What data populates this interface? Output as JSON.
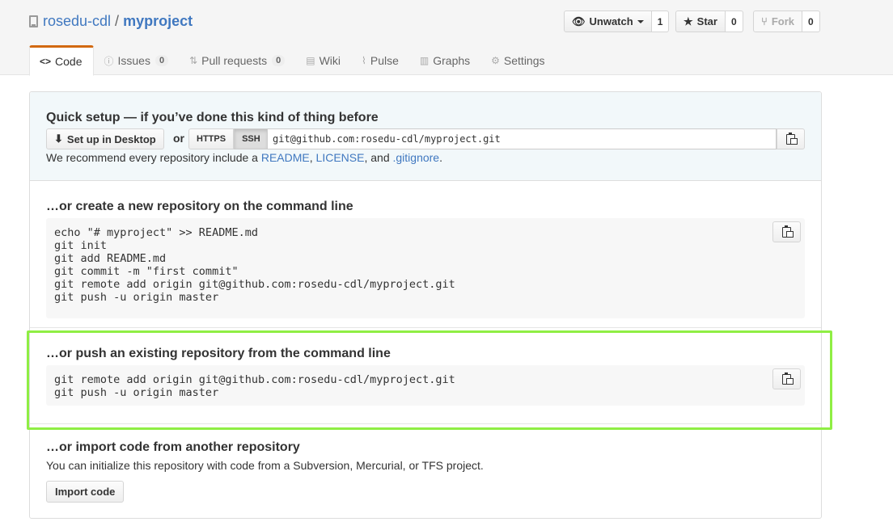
{
  "repo": {
    "owner": "rosedu-cdl",
    "separator": "/",
    "name": "myproject"
  },
  "actions": {
    "watch": {
      "label": "Unwatch",
      "icon": "eye-icon",
      "count": "1"
    },
    "star": {
      "label": "Star",
      "icon": "star-icon",
      "count": "0"
    },
    "fork": {
      "label": "Fork",
      "icon": "fork-icon",
      "count": "0"
    }
  },
  "tabs": [
    {
      "label": "Code",
      "icon": "code-icon",
      "active": true
    },
    {
      "label": "Issues",
      "icon": "issue-icon",
      "counter": "0"
    },
    {
      "label": "Pull requests",
      "icon": "pull-request-icon",
      "counter": "0"
    },
    {
      "label": "Wiki",
      "icon": "book-icon"
    },
    {
      "label": "Pulse",
      "icon": "pulse-icon"
    },
    {
      "label": "Graphs",
      "icon": "graph-icon"
    },
    {
      "label": "Settings",
      "icon": "gear-icon"
    }
  ],
  "quick_setup": {
    "title": "Quick setup — if you’ve done this kind of thing before",
    "desktop_button": "Set up in Desktop",
    "or": "or",
    "protocols": [
      "HTTPS",
      "SSH"
    ],
    "selected_protocol": "SSH",
    "clone_url": "git@github.com:rosedu-cdl/myproject.git",
    "recommend_prefix": "We recommend every repository include a ",
    "readme": "README",
    "comma": ", ",
    "license": "LICENSE",
    "and": ", and ",
    "gitignore": ".gitignore",
    "period": "."
  },
  "new_repo": {
    "title": "…or create a new repository on the command line",
    "code": "echo \"# myproject\" >> README.md\ngit init\ngit add README.md\ngit commit -m \"first commit\"\ngit remote add origin git@github.com:rosedu-cdl/myproject.git\ngit push -u origin master"
  },
  "push_existing": {
    "title": "…or push an existing repository from the command line",
    "code": "git remote add origin git@github.com:rosedu-cdl/myproject.git\ngit push -u origin master"
  },
  "import": {
    "title": "…or import code from another repository",
    "description": "You can initialize this repository with code from a Subversion, Mercurial, or TFS project.",
    "button": "Import code"
  },
  "colors": {
    "link": "#4078c0",
    "active_tab_accent": "#d26911",
    "highlight": "#8fee44"
  }
}
